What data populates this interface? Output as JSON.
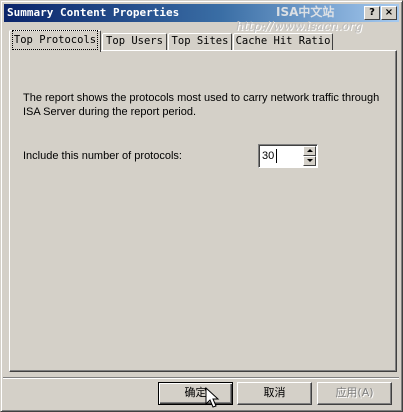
{
  "window": {
    "title": "Summary Content Properties",
    "help_label": "?",
    "close_label": "×"
  },
  "watermark": {
    "name": "ISA中文站",
    "url": "http://www.isacn.org"
  },
  "tabs": [
    {
      "label": "Top Protocols",
      "active": true
    },
    {
      "label": "Top Users",
      "active": false
    },
    {
      "label": "Top Sites",
      "active": false
    },
    {
      "label": "Cache Hit Ratio",
      "active": false
    }
  ],
  "panel": {
    "description": "The report shows the protocols most used to carry network traffic through ISA Server during the report period.",
    "count_label": "Include this number of protocols:",
    "count_value": "30"
  },
  "buttons": {
    "ok": "确定",
    "cancel": "取消",
    "apply": "应用(A)"
  },
  "icons": {
    "spin_up": "arrow-up-icon",
    "spin_down": "arrow-down-icon",
    "cursor": "mouse-pointer-icon"
  }
}
